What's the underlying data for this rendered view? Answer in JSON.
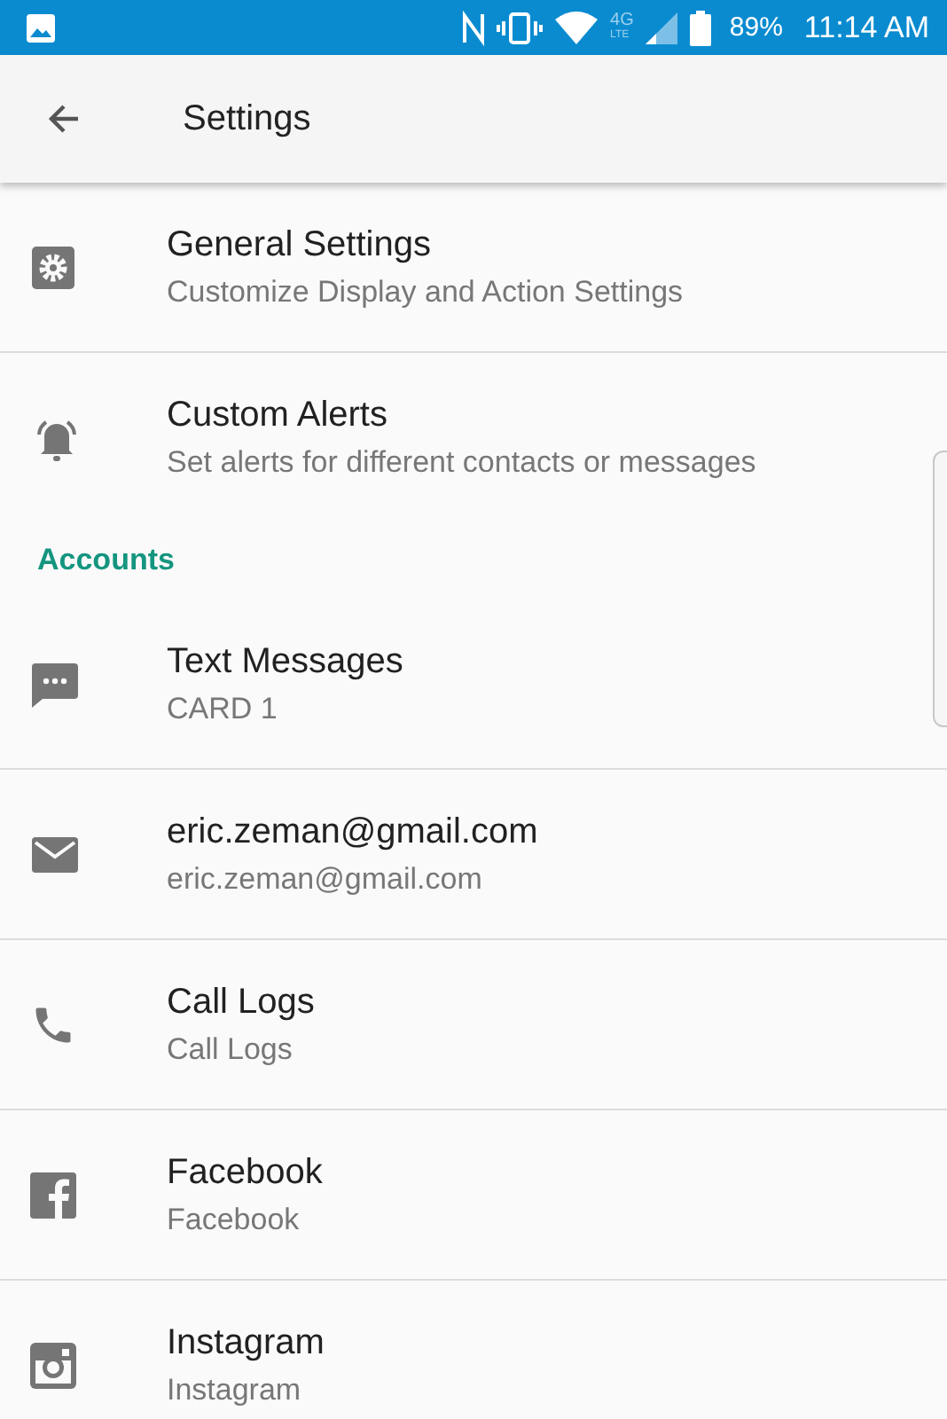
{
  "status_bar": {
    "network": "4G",
    "network_sub": "LTE",
    "battery": "89%",
    "time": "11:14 AM"
  },
  "app_bar": {
    "title": "Settings"
  },
  "sections": [
    {
      "items": [
        {
          "kind": "gear",
          "title": "General Settings",
          "subtitle": "Customize Display and Action Settings"
        },
        {
          "kind": "bell",
          "title": "Custom Alerts",
          "subtitle": "Set alerts for different contacts or messages"
        }
      ]
    },
    {
      "header": "Accounts",
      "items": [
        {
          "kind": "message",
          "title": "Text Messages",
          "subtitle": "CARD 1"
        },
        {
          "kind": "mail",
          "title": "eric.zeman@gmail.com",
          "subtitle": "eric.zeman@gmail.com"
        },
        {
          "kind": "phone",
          "title": "Call Logs",
          "subtitle": "Call Logs"
        },
        {
          "kind": "facebook",
          "title": "Facebook",
          "subtitle": "Facebook"
        },
        {
          "kind": "instagram",
          "title": "Instagram",
          "subtitle": "Instagram"
        }
      ]
    }
  ]
}
